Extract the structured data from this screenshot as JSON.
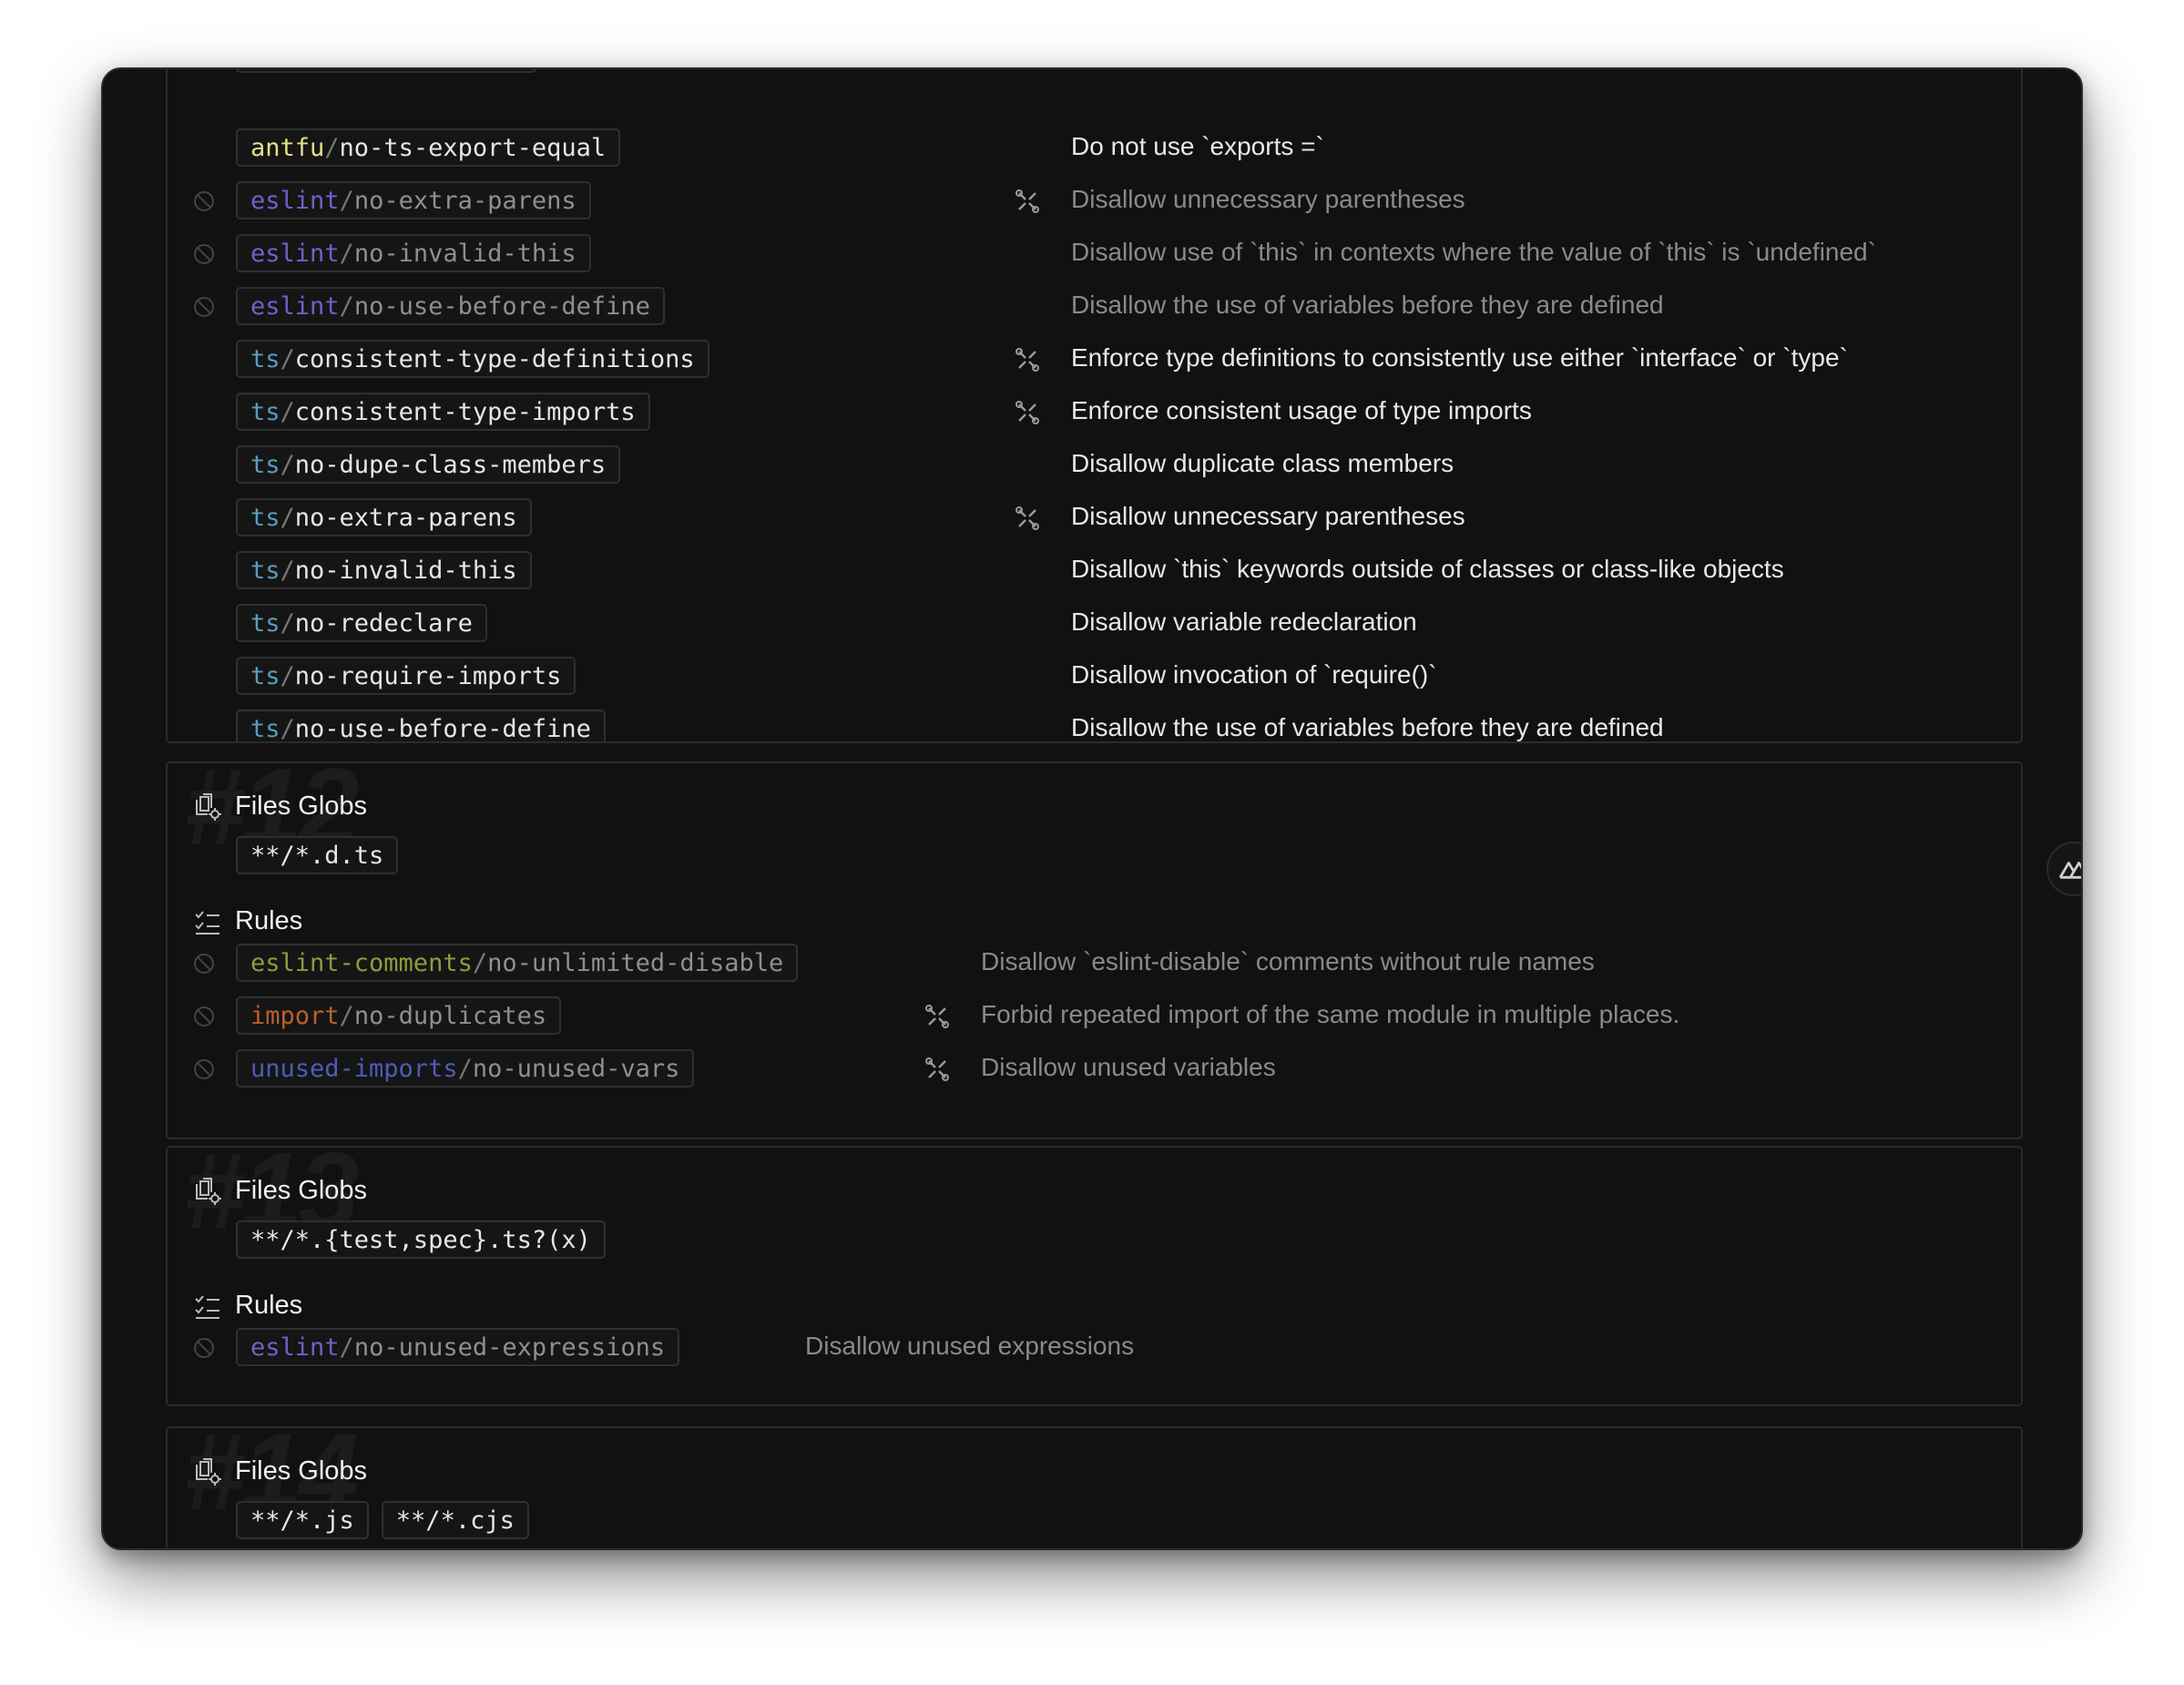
{
  "block11": {
    "rules": [
      {
        "plugin": "antfu",
        "name": "no-ts-export-equal",
        "desc": "Do not use `exports =`",
        "disabled": false,
        "fixable": false,
        "color": "#e8df8a"
      },
      {
        "plugin": "eslint",
        "name": "no-extra-parens",
        "desc": "Disallow unnecessary parentheses",
        "disabled": true,
        "fixable": true,
        "color": "#6b63c8"
      },
      {
        "plugin": "eslint",
        "name": "no-invalid-this",
        "desc": "Disallow use of `this` in contexts where the value of `this` is `undefined`",
        "disabled": true,
        "fixable": false,
        "color": "#6b63c8"
      },
      {
        "plugin": "eslint",
        "name": "no-use-before-define",
        "desc": "Disallow the use of variables before they are defined",
        "disabled": true,
        "fixable": false,
        "color": "#6b63c8"
      },
      {
        "plugin": "ts",
        "name": "consistent-type-definitions",
        "desc": "Enforce type definitions to consistently use either `interface` or `type`",
        "disabled": false,
        "fixable": true,
        "color": "#5a9bbf"
      },
      {
        "plugin": "ts",
        "name": "consistent-type-imports",
        "desc": "Enforce consistent usage of type imports",
        "disabled": false,
        "fixable": true,
        "color": "#5a9bbf"
      },
      {
        "plugin": "ts",
        "name": "no-dupe-class-members",
        "desc": "Disallow duplicate class members",
        "disabled": false,
        "fixable": false,
        "color": "#5a9bbf"
      },
      {
        "plugin": "ts",
        "name": "no-extra-parens",
        "desc": "Disallow unnecessary parentheses",
        "disabled": false,
        "fixable": true,
        "color": "#5a9bbf"
      },
      {
        "plugin": "ts",
        "name": "no-invalid-this",
        "desc": "Disallow `this` keywords outside of classes or class-like objects",
        "disabled": false,
        "fixable": false,
        "color": "#5a9bbf"
      },
      {
        "plugin": "ts",
        "name": "no-redeclare",
        "desc": "Disallow variable redeclaration",
        "disabled": false,
        "fixable": false,
        "color": "#5a9bbf"
      },
      {
        "plugin": "ts",
        "name": "no-require-imports",
        "desc": "Disallow invocation of `require()`",
        "disabled": false,
        "fixable": false,
        "color": "#5a9bbf"
      },
      {
        "plugin": "ts",
        "name": "no-use-before-define",
        "desc": "Disallow the use of variables before they are defined",
        "disabled": false,
        "fixable": false,
        "color": "#5a9bbf"
      }
    ]
  },
  "block12": {
    "number": "#12",
    "files_label": "Files Globs",
    "globs": [
      "**/*.d.ts"
    ],
    "rules_label": "Rules",
    "rules": [
      {
        "plugin": "eslint-comments",
        "name": "no-unlimited-disable",
        "desc": "Disallow `eslint-disable` comments without rule names",
        "disabled": true,
        "fixable": false,
        "color": "#8f9a3e"
      },
      {
        "plugin": "import",
        "name": "no-duplicates",
        "desc": "Forbid repeated import of the same module in multiple places.",
        "disabled": true,
        "fixable": true,
        "color": "#b8602f"
      },
      {
        "plugin": "unused-imports",
        "name": "no-unused-vars",
        "desc": "Disallow unused variables",
        "disabled": true,
        "fixable": true,
        "color": "#4f5bb8"
      }
    ]
  },
  "block13": {
    "number": "#13",
    "files_label": "Files Globs",
    "globs": [
      "**/*.{test,spec}.ts?(x)"
    ],
    "rules_label": "Rules",
    "rules": [
      {
        "plugin": "eslint",
        "name": "no-unused-expressions",
        "desc": "Disallow unused expressions",
        "disabled": true,
        "fixable": false,
        "color": "#6b63c8"
      }
    ]
  },
  "block14": {
    "number": "#14",
    "files_label": "Files Globs",
    "globs": [
      "**/*.js",
      "**/*.cjs"
    ]
  },
  "icons": {
    "disabled": "ban-icon",
    "fixable": "wrench-icon",
    "files": "files-gear-icon",
    "rules": "list-check-icon",
    "devtools": "nuxt-icon"
  }
}
